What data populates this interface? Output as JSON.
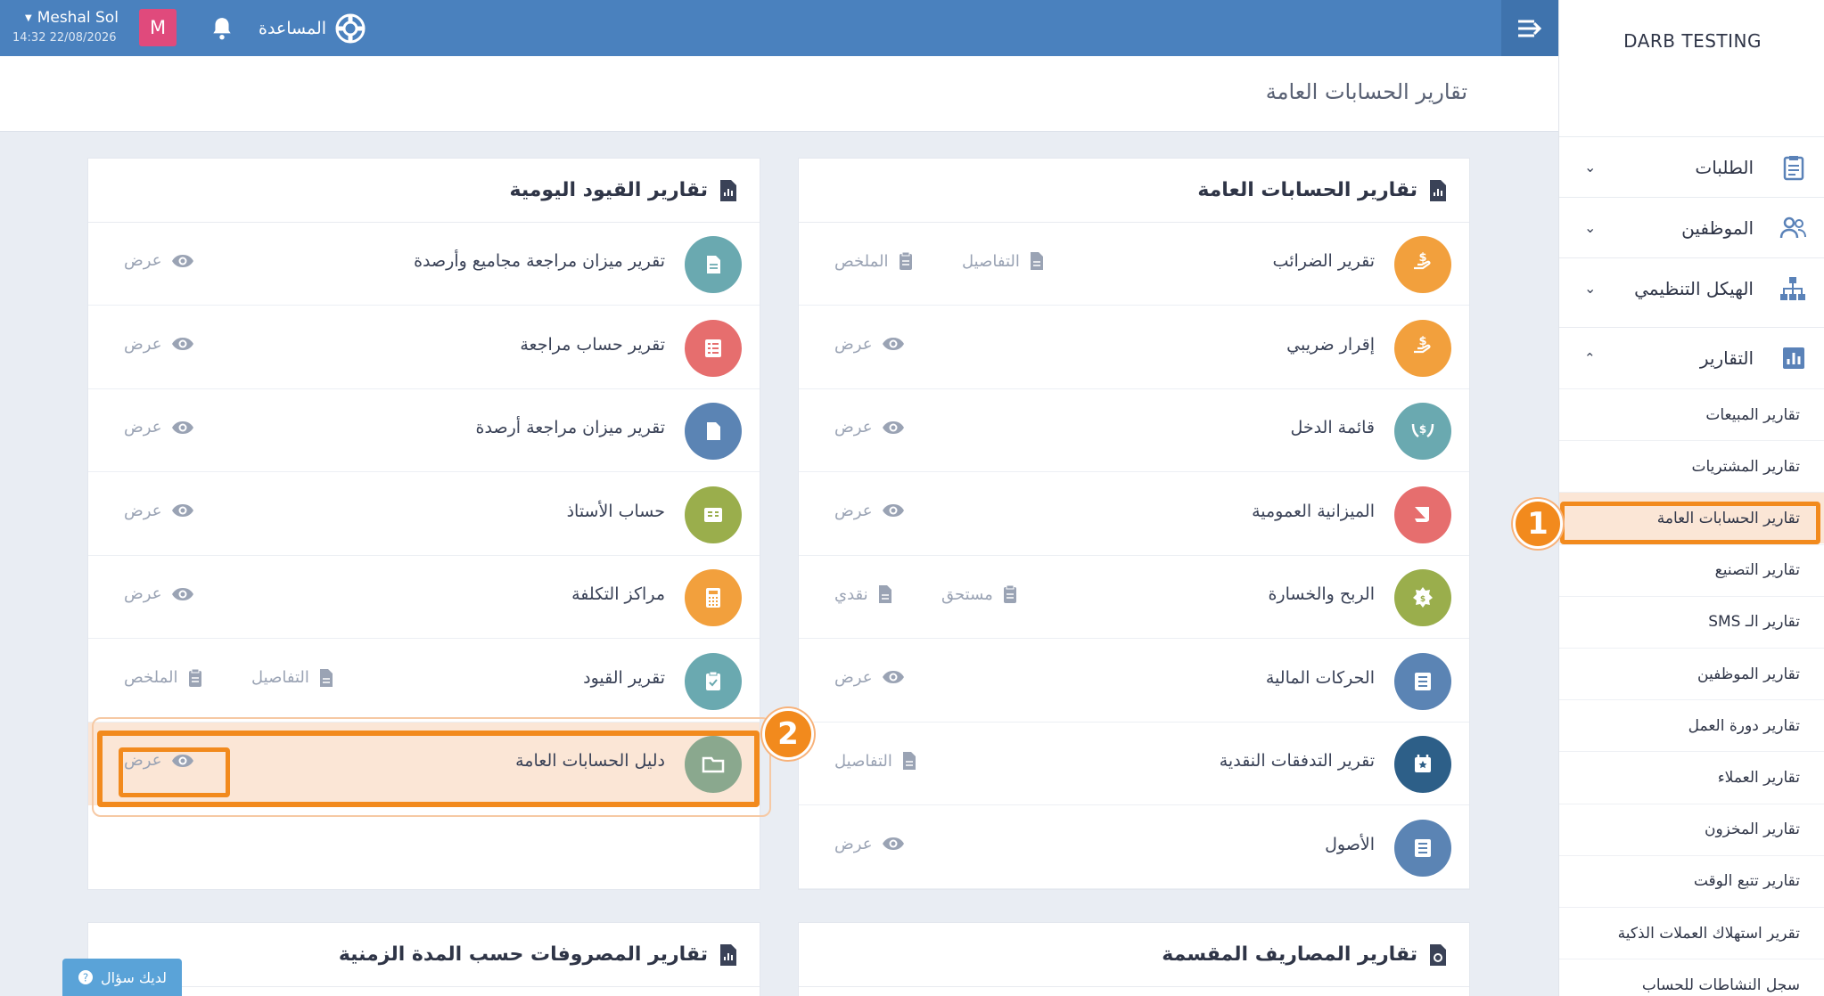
{
  "topbar": {
    "help_label": "المساعدة",
    "avatar_letter": "M",
    "user_name": "Meshal Sol",
    "user_datetime": "14:32 22/08/2026"
  },
  "page": {
    "title": "تقارير الحسابات العامة"
  },
  "sidebar": {
    "brand": "DARB TESTING",
    "nav": [
      {
        "label": "الطلبات",
        "icon": "clipboard-icon"
      },
      {
        "label": "الموظفين",
        "icon": "users-icon"
      },
      {
        "label": "الهيكل التنظيمي",
        "icon": "org-chart-icon"
      },
      {
        "label": "التقارير",
        "icon": "bar-chart-icon"
      }
    ],
    "sub": [
      "تقارير المبيعات",
      "تقارير المشتريات",
      "تقارير الحسابات العامة",
      "تقارير التصنيع",
      "تقارير الـ SMS",
      "تقارير الموظفين",
      "تقارير دورة العمل",
      "تقارير العملاء",
      "تقارير المخزون",
      "تقارير تتبع الوقت",
      "تقرير استهلاك العملات الذكية",
      "سجل النشاطات للحساب"
    ],
    "active_sub_index": 2
  },
  "annotations": {
    "step1": "1",
    "step2": "2"
  },
  "actions": {
    "view": "عرض",
    "details": "التفاصيل",
    "summary": "الملخص",
    "accrual": "مستحق",
    "cash": "نقدي"
  },
  "panels": {
    "general": {
      "title": "تقارير الحسابات العامة",
      "rows": [
        {
          "label": "تقرير الضرائب",
          "color": "#f2a03d"
        },
        {
          "label": "إقرار ضريبي",
          "color": "#f2a03d"
        },
        {
          "label": "قائمة الدخل",
          "color": "#6aa9b0"
        },
        {
          "label": "الميزانية العمومية",
          "color": "#e66e6e"
        },
        {
          "label": "الربح والخسارة",
          "color": "#9aae4c"
        },
        {
          "label": "الحركات المالية",
          "color": "#5b84b4"
        },
        {
          "label": "تقرير التدفقات النقدية",
          "color": "#2d5f88"
        },
        {
          "label": "الأصول",
          "color": "#5b84b4"
        }
      ]
    },
    "journal": {
      "title": "تقارير القيود اليومية",
      "rows": [
        {
          "label": "تقرير ميزان مراجعة مجاميع وأرصدة",
          "color": "#6aa9b0"
        },
        {
          "label": "تقرير حساب مراجعة",
          "color": "#e66e6e"
        },
        {
          "label": "تقرير ميزان مراجعة أرصدة",
          "color": "#5b84b4"
        },
        {
          "label": "حساب الأستاذ",
          "color": "#9aae4c"
        },
        {
          "label": "مراكز التكلفة",
          "color": "#f2a03d"
        },
        {
          "label": "تقرير القيود",
          "color": "#6aa9b0"
        },
        {
          "label": "دليل الحسابات العامة",
          "color": "#8aa88e"
        }
      ]
    },
    "split": {
      "title": "تقارير المصاريف المقسمة"
    },
    "period": {
      "title": "تقارير المصروفات حسب المدة الزمنية"
    }
  },
  "ask": {
    "label": "لديك سؤال"
  },
  "colors": {
    "topbar": "#4a81be",
    "accent": "#f28a1d",
    "highlight_bg": "#fbe6d6"
  }
}
